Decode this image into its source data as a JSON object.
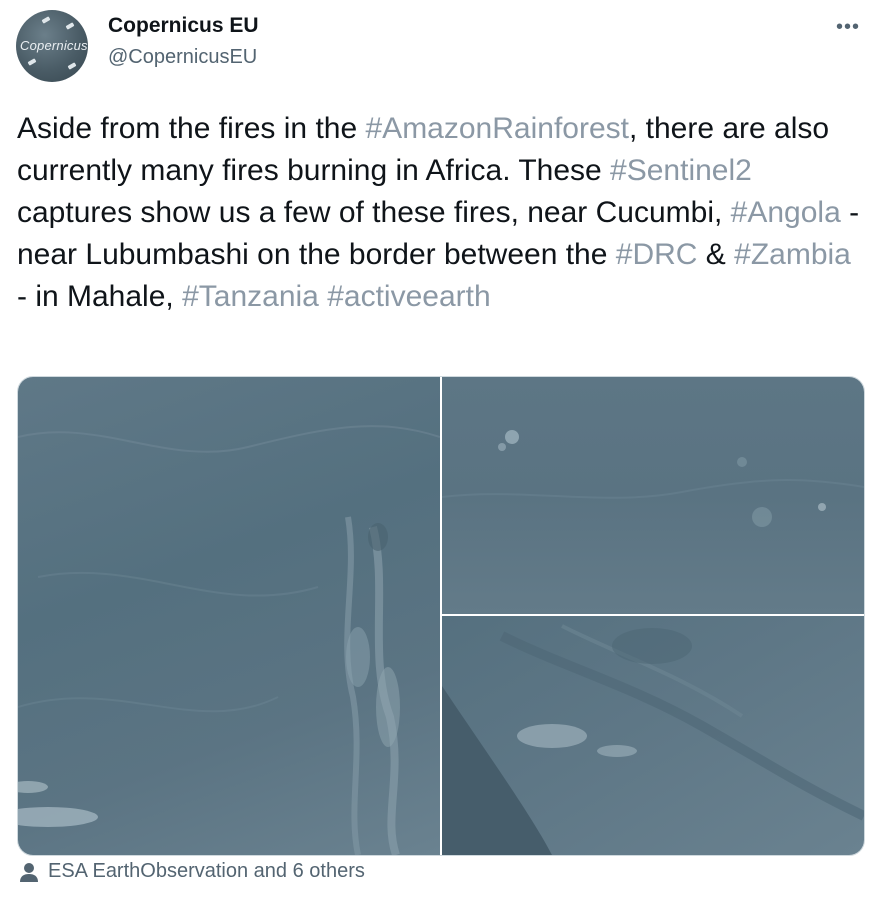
{
  "author": {
    "name": "Copernicus EU",
    "handle": "@CopernicusEU",
    "avatar_text": "Copernicus"
  },
  "more_icon": "more-icon",
  "tweet": {
    "segments": [
      {
        "text": "Aside from the fires in the ",
        "tag": false
      },
      {
        "text": "#AmazonRainforest",
        "tag": true
      },
      {
        "text": ", there are also currently many fires burning in Africa. These ",
        "tag": false
      },
      {
        "text": "#Sentinel2",
        "tag": true
      },
      {
        "text": " captures show us a few of these fires, near Cucumbi, ",
        "tag": false
      },
      {
        "text": "#Angola",
        "tag": true
      },
      {
        "text": " - near Lubumbashi on the border between the ",
        "tag": false
      },
      {
        "text": "#DRC",
        "tag": true
      },
      {
        "text": " & ",
        "tag": false
      },
      {
        "text": "#Zambia",
        "tag": true
      },
      {
        "text": " - in Mahale, ",
        "tag": false
      },
      {
        "text": "#Tanzania",
        "tag": true
      },
      {
        "text": " ",
        "tag": false
      },
      {
        "text": "#activeearth",
        "tag": true
      }
    ]
  },
  "media": {
    "images": [
      "satellite-image-1",
      "satellite-image-2",
      "satellite-image-3"
    ]
  },
  "liked_by": {
    "icon": "person-icon",
    "text": "ESA EarthObservation and 6 others"
  },
  "colors": {
    "text": "#0f1419",
    "secondary": "#536471",
    "hashtag": "#8b98a5"
  }
}
